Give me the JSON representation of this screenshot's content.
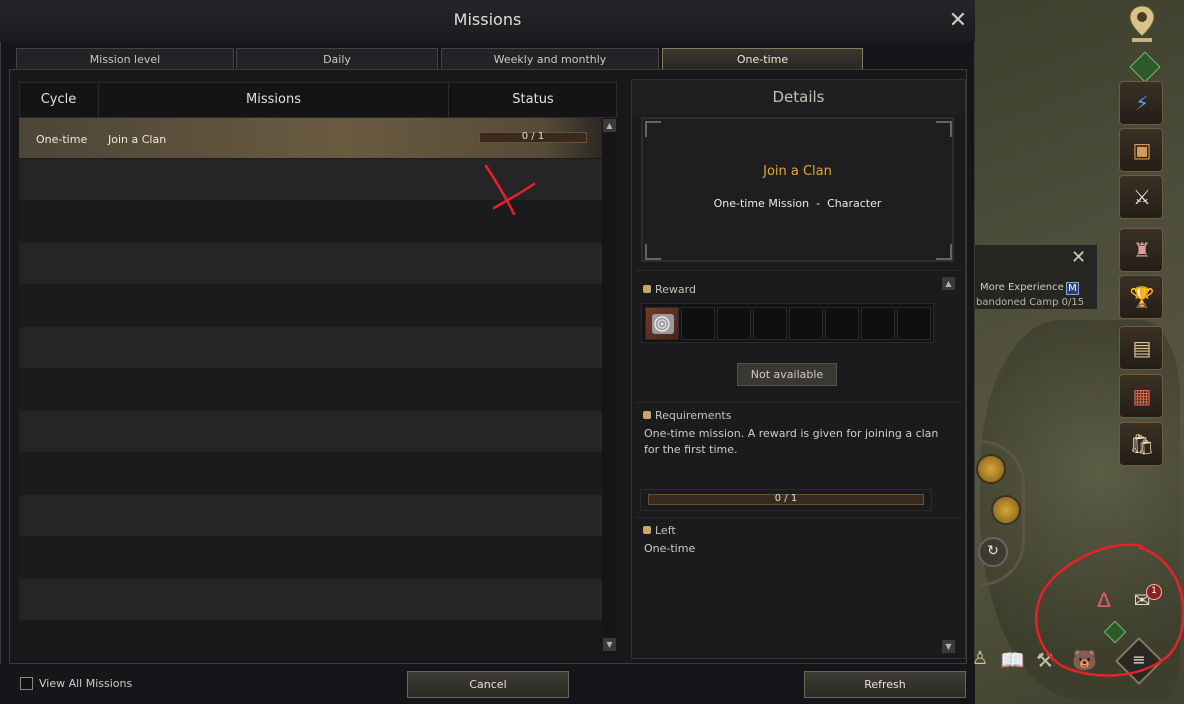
{
  "window": {
    "title": "Missions",
    "close_symbol": "✕"
  },
  "tabs": [
    {
      "label": "Mission level",
      "active": false
    },
    {
      "label": "Daily",
      "active": false
    },
    {
      "label": "Weekly and monthly",
      "active": false
    },
    {
      "label": "One-time",
      "active": true
    }
  ],
  "list": {
    "headers": {
      "cycle": "Cycle",
      "missions": "Missions",
      "status": "Status"
    },
    "rows": [
      {
        "cycle": "One-time",
        "mission": "Join a Clan",
        "progress_text": "0 / 1",
        "progress": 0.0
      }
    ]
  },
  "details": {
    "title": "Details",
    "mission_name": "Join a Clan",
    "mission_type": "One-time Mission",
    "separator": "-",
    "mission_category": "Character",
    "reward_label": "Reward",
    "reward_button": "Not available",
    "requirements_label": "Requirements",
    "requirements_text": "One-time mission. A reward is given for joining a clan for the first time.",
    "requirements_progress_text": "0 / 1",
    "left_label": "Left",
    "left_value": "One-time"
  },
  "bottom": {
    "view_all_label": "View All Missions",
    "view_all_checked": false,
    "cancel_label": "Cancel",
    "refresh_label": "Refresh"
  },
  "hud": {
    "quest_popup_title": "More Experience",
    "quest_popup_key": "M",
    "quest_popup_sub": "bandoned Camp 0/15",
    "notification_count": "1"
  },
  "colors": {
    "accent_orange": "#e8a53c",
    "annotation_red": "#e8202a"
  }
}
